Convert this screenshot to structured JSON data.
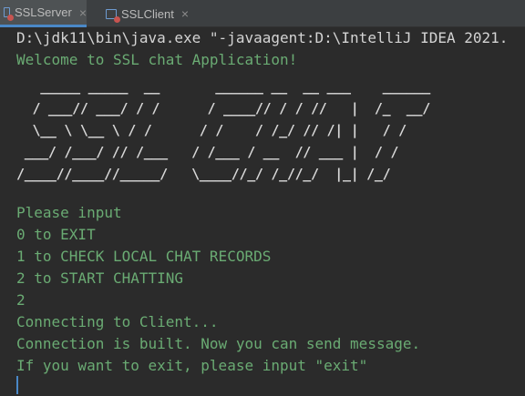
{
  "tabs": [
    {
      "label": "SSLServer",
      "close": "×",
      "active": true
    },
    {
      "label": "SSLClient",
      "close": "×",
      "active": false
    }
  ],
  "console": {
    "command": "D:\\jdk11\\bin\\java.exe \"-javaagent:D:\\IntelliJ IDEA 2021.",
    "welcome": "Welcome to SSL chat Application!",
    "banner": "   _____ _____  __       ______ __  __ ___    ______\n  / ___// ___/ / /      / ____// / / //   |  /_  __/\n  \\__ \\ \\__ \\ / /      / /    / /_/ // /| |   / /\n ___/ /___/ // /___   / /___ / __  // ___ |  / /\n/____//____//_____/   \\____//_/ /_//_/  |_| /_/",
    "lines": [
      "Please input",
      "0 to EXIT",
      "1 to CHECK LOCAL CHAT RECORDS",
      "2 to START CHATTING",
      "2",
      "Connecting to Client...",
      "Connection is built. Now you can send message.",
      "If you want to exit, please input \"exit\""
    ]
  },
  "colors": {
    "background": "#2b2b2b",
    "output_text": "#6aab73",
    "command_text": "#d4d4d4",
    "tab_active_underline": "#4a88c7"
  }
}
